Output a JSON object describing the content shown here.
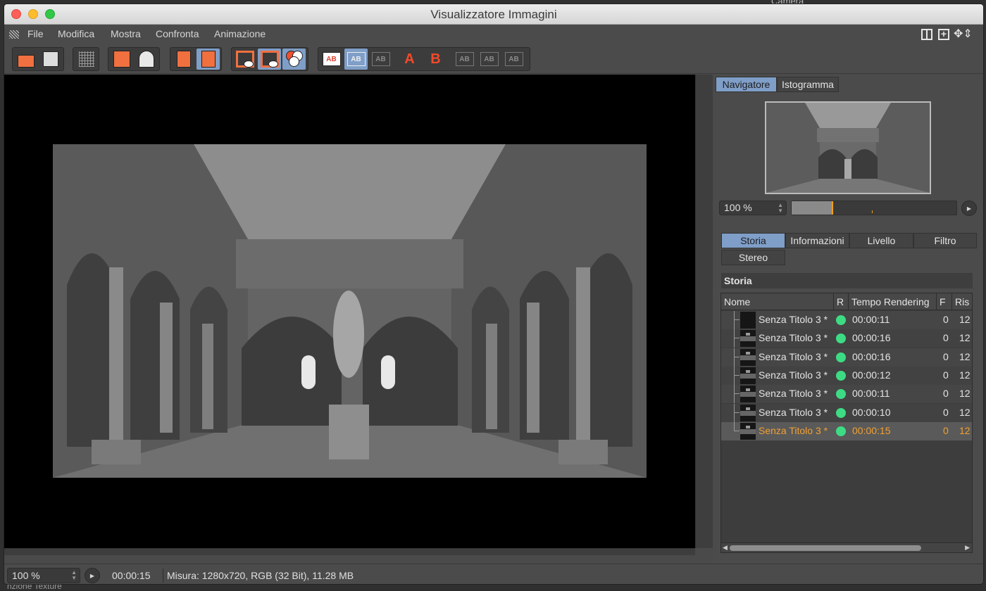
{
  "window": {
    "title": "Visualizzatore Immagini"
  },
  "background": {
    "peek_label": "Camera",
    "bottom_label": "nzione   Texture"
  },
  "menu": [
    "File",
    "Modifica",
    "Mostra",
    "Confronta",
    "Animazione"
  ],
  "toolbar_icons": [
    "open-file-icon",
    "save-file-icon",
    "grid-icon",
    "add-to-history-icon",
    "save-user-icon",
    "delete-frame-icon",
    "film-stack-icon",
    "frame-view-icon",
    "frame-view-active-icon",
    "rgb-channels-icon",
    "ab-compare-icon",
    "ab-split-icon",
    "ab-overlay-icon",
    "set-a-icon",
    "set-b-icon",
    "ab-icon-1",
    "ab-icon-2",
    "ab-icon-3"
  ],
  "toolbar_letters": {
    "a": "A",
    "b": "B",
    "ab": "AB"
  },
  "navigator": {
    "tabs": [
      "Navigatore",
      "Istogramma"
    ],
    "active_tab": "Navigatore",
    "zoom": "100 %",
    "zoom_fraction": 0.24
  },
  "info_tabs": {
    "row1": [
      "Storia",
      "Informazioni",
      "Livello",
      "Filtro"
    ],
    "row2": [
      "Stereo"
    ],
    "active_tab": "Storia"
  },
  "history": {
    "title": "Storia",
    "columns": [
      "Nome",
      "R",
      "Tempo Rendering",
      "F",
      "Ris"
    ],
    "rows": [
      {
        "name": "Senza Titolo 3 *",
        "time": "00:00:11",
        "f": "0",
        "ris": "12"
      },
      {
        "name": "Senza Titolo 3 *",
        "time": "00:00:16",
        "f": "0",
        "ris": "12"
      },
      {
        "name": "Senza Titolo 3 *",
        "time": "00:00:16",
        "f": "0",
        "ris": "12"
      },
      {
        "name": "Senza Titolo 3 *",
        "time": "00:00:12",
        "f": "0",
        "ris": "12"
      },
      {
        "name": "Senza Titolo 3 *",
        "time": "00:00:11",
        "f": "0",
        "ris": "12"
      },
      {
        "name": "Senza Titolo 3 *",
        "time": "00:00:10",
        "f": "0",
        "ris": "12"
      },
      {
        "name": "Senza Titolo 3 *",
        "time": "00:00:15",
        "f": "0",
        "ris": "12"
      }
    ],
    "selected_index": 6,
    "status_color": "#3ddc84",
    "selected_color": "#f2a032"
  },
  "status": {
    "zoom": "100 %",
    "time": "00:00:15",
    "info": "Misura: 1280x720, RGB (32 Bit), 11.28 MB"
  },
  "colors": {
    "accent": "#7f9ec8",
    "toolbar_orange": "#f07040"
  }
}
